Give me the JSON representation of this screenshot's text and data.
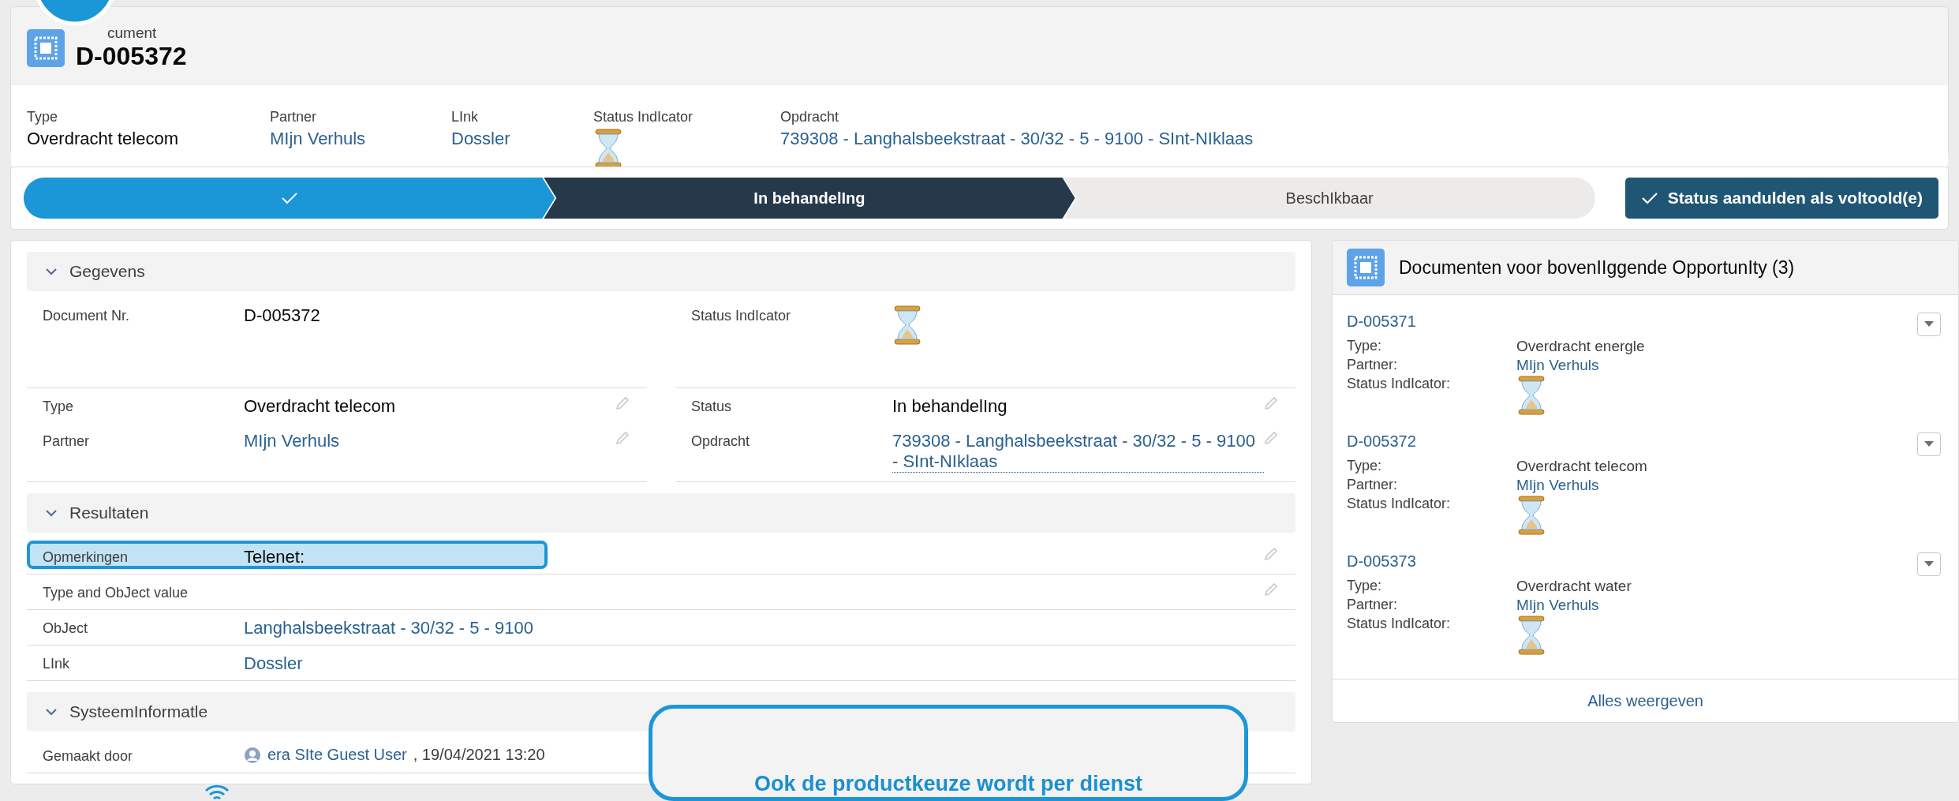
{
  "record": {
    "object_label": "cument",
    "title": "D-005372"
  },
  "highlights": [
    {
      "kind": "text",
      "label": "Type",
      "value": "Overdracht telecom"
    },
    {
      "kind": "link",
      "label": "Partner",
      "value": "MIjn Verhuls"
    },
    {
      "kind": "link",
      "label": "LInk",
      "value": "Dossler"
    },
    {
      "kind": "icon",
      "label": "Status IndIcator"
    },
    {
      "kind": "link",
      "label": "Opdracht",
      "value": "739308 - Langhalsbeekstraat - 30/32 - 5 - 9100 - SInt-NIklaas"
    }
  ],
  "path": {
    "steps": [
      {
        "completed": true,
        "selected": false
      },
      {
        "completed": false,
        "selected": true,
        "label": "In behandelIng"
      },
      {
        "completed": false,
        "selected": false,
        "label": "BeschIkbaar"
      }
    ],
    "button": "Status aandulden als voltoold(e)"
  },
  "sections": [
    {
      "title": "Gegevens",
      "expanded": true,
      "kind": "two-column",
      "rows": [
        {
          "left": {
            "label": "Document Nr.",
            "kind": "text",
            "value": "D-005372",
            "editable": false
          },
          "right": {
            "label": "Status IndIcator",
            "kind": "icon",
            "editable": false
          }
        },
        {
          "left": {
            "label": "Type",
            "kind": "text",
            "value": "Overdracht telecom",
            "editable": true
          },
          "right": {
            "label": "Status",
            "kind": "text",
            "value": "In behandelIng",
            "editable": true
          }
        },
        {
          "left": {
            "label": "Partner",
            "kind": "link",
            "value": "MIjn Verhuls",
            "editable": true
          },
          "right": {
            "label": "Opdracht",
            "kind": "link",
            "value": "739308 - Langhalsbeekstraat - 30/32 - 5 - 9100 - SInt-NIklaas",
            "editable": true
          }
        }
      ]
    },
    {
      "title": "Resultaten",
      "expanded": true,
      "kind": "one-column",
      "rows": [
        {
          "label": "Opmerkingen",
          "kind": "text",
          "value": "Telenet:",
          "editable": true,
          "highlighted": true
        },
        {
          "label": "Type and ObJect value",
          "kind": "text",
          "editable": true,
          "highlighted": false
        },
        {
          "label": "ObJect",
          "kind": "link",
          "value": "Langhalsbeekstraat - 30/32 - 5 - 9100",
          "editable": false,
          "highlighted": false
        },
        {
          "label": "LInk",
          "kind": "link",
          "value": "Dossler",
          "editable": false,
          "highlighted": false
        }
      ]
    },
    {
      "title": "SysteemInformatle",
      "expanded": true,
      "kind": "one-column",
      "rows": [
        {
          "label": "Gemaakt door",
          "kind": "user",
          "value": "era SIte Guest User",
          "suffix": ", 19/04/2021 13:20",
          "editable": false,
          "highlighted": false
        }
      ]
    }
  ],
  "related": {
    "title": "Documenten voor bovenIIggende OpportunIty (3)",
    "items": [
      {
        "id": "D-005371",
        "fields": [
          {
            "label": "Type:",
            "kind": "text",
            "value": "Overdracht energle"
          },
          {
            "label": "Partner:",
            "kind": "link",
            "value": "MIjn Verhuls"
          },
          {
            "label": "Status IndIcator:",
            "kind": "icon"
          }
        ]
      },
      {
        "id": "D-005372",
        "fields": [
          {
            "label": "Type:",
            "kind": "text",
            "value": "Overdracht telecom"
          },
          {
            "label": "Partner:",
            "kind": "link",
            "value": "MIjn Verhuls"
          },
          {
            "label": "Status IndIcator:",
            "kind": "icon"
          }
        ]
      },
      {
        "id": "D-005373",
        "fields": [
          {
            "label": "Type:",
            "kind": "text",
            "value": "Overdracht water"
          },
          {
            "label": "Partner:",
            "kind": "link",
            "value": "MIjn Verhuls"
          },
          {
            "label": "Status IndIcator:",
            "kind": "icon"
          }
        ]
      }
    ],
    "footer": "Alles weergeven"
  },
  "callout": {
    "text": "Ook de productkeuze wordt per dienst"
  }
}
